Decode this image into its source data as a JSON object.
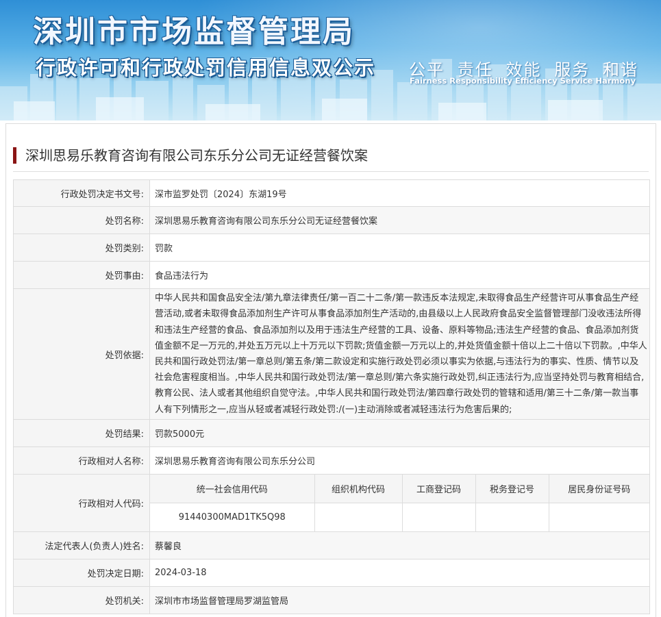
{
  "banner": {
    "title": "深圳市市场监督管理局",
    "subtitle": "行政许可和行政处罚信用信息双公示",
    "values_cn": [
      "公平",
      "责任",
      "效能",
      "服务",
      "和谐"
    ],
    "values_en": [
      "Fairness",
      "Responsibility",
      "Efficiency",
      "Service",
      "Harmony"
    ]
  },
  "case_title": "深圳思易乐教育咨询有限公司东乐分公司无证经营餐饮案",
  "fields": {
    "decision_no": {
      "label": "行政处罚决定书文号:",
      "value": "深市监罗处罚〔2024〕东湖19号"
    },
    "penalty_name": {
      "label": "处罚名称:",
      "value": "深圳思易乐教育咨询有限公司东乐分公司无证经营餐饮案"
    },
    "penalty_type": {
      "label": "处罚类别:",
      "value": "罚款"
    },
    "penalty_reason": {
      "label": "处罚事由:",
      "value": "食品违法行为"
    },
    "penalty_basis": {
      "label": "处罚依据:",
      "value": "中华人民共和国食品安全法/第九章法律责任/第一百二十二条/第一款违反本法规定,未取得食品生产经营许可从事食品生产经营活动,或者未取得食品添加剂生产许可从事食品添加剂生产活动的,由县级以上人民政府食品安全监督管理部门没收违法所得和违法生产经营的食品、食品添加剂以及用于违法生产经营的工具、设备、原料等物品;违法生产经营的食品、食品添加剂货值金额不足一万元的,并处五万元以上十万元以下罚款;货值金额一万元以上的,并处货值金额十倍以上二十倍以下罚款。,中华人民共和国行政处罚法/第一章总则/第五条/第二款设定和实施行政处罚必须以事实为依据,与违法行为的事实、性质、情节以及社会危害程度相当。,中华人民共和国行政处罚法/第一章总则/第六条实施行政处罚,纠正违法行为,应当坚持处罚与教育相结合,教育公民、法人或者其他组织自觉守法。,中华人民共和国行政处罚法/第四章行政处罚的管辖和适用/第三十二条/第一款当事人有下列情形之一,应当从轻或者减轻行政处罚:/(一)主动消除或者减轻违法行为危害后果的;"
    },
    "penalty_result": {
      "label": "处罚结果:",
      "value": "罚款5000元"
    },
    "party_name": {
      "label": "行政相对人名称:",
      "value": "深圳思易乐教育咨询有限公司东乐分公司"
    },
    "party_code": {
      "label": "行政相对人代码:",
      "headers": [
        "统一社会信用代码",
        "组织机构代码",
        "工商登记码",
        "税务登记号",
        "居民身份证号码"
      ],
      "values": [
        "91440300MAD1TK5Q98",
        "",
        "",
        "",
        ""
      ]
    },
    "legal_rep": {
      "label": "法定代表人(负责人)姓名:",
      "value": "蔡馨良"
    },
    "decision_date": {
      "label": "处罚决定日期:",
      "value": "2024-03-18"
    },
    "authority": {
      "label": "处罚机关:",
      "value": "深圳市市场监督管理局罗湖监管局"
    }
  },
  "colors": {
    "accent_bar": "#8b1515",
    "label_bg": "#f5f5f5",
    "border": "#dcdcdc"
  }
}
